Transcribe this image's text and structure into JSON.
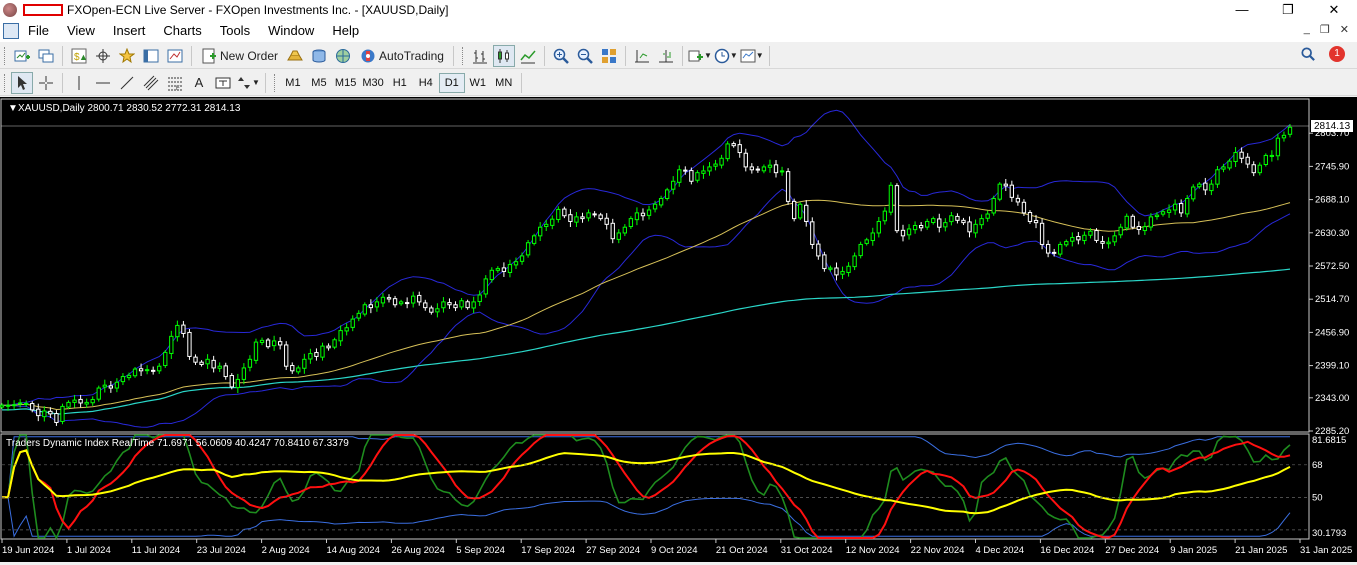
{
  "window": {
    "title": "FXOpen-ECN Live Server - FXOpen Investments Inc. - [XAUUSD,Daily]",
    "controls": [
      "—",
      "❐",
      "✕"
    ]
  },
  "menu": {
    "items": [
      "File",
      "View",
      "Insert",
      "Charts",
      "Tools",
      "Window",
      "Help"
    ],
    "mdi_controls": [
      "_",
      "❐",
      "✕"
    ]
  },
  "toolbar": {
    "new_order_label": "New Order",
    "autotrading_label": "AutoTrading",
    "notification_count": "1"
  },
  "drawing_toolbar": {
    "text_tool": "A",
    "timeframes": [
      "M1",
      "M5",
      "M15",
      "M30",
      "H1",
      "H4",
      "D1",
      "W1",
      "MN"
    ],
    "active_timeframe": "D1"
  },
  "chart": {
    "header": "XAUUSD,Daily  2800.71 2830.52 2772.31 2814.13",
    "current_price": "2814.13",
    "hidden_price_label": "2803.70",
    "indicator_header": "Traders Dynamic Index RealTime 71.6971 56.0609 40.4247 70.8410 67.3379",
    "colors": {
      "background": "#000000",
      "bull_candle": "#00ff00",
      "bear_candle": "#ffffff",
      "bollinger": "#2828d8",
      "ma_mid": "#d6c058",
      "ma_long": "#2ad6c8",
      "rsi_green": "#1e8c1e",
      "signal_red": "#ff1010",
      "mbl_yellow": "#ffff00",
      "volatility_band": "#3a6ee0"
    }
  },
  "chart_data": [
    {
      "type": "candlestick",
      "title": "XAUUSD,Daily",
      "ohlc_last": {
        "open": 2800.71,
        "high": 2830.52,
        "low": 2772.31,
        "close": 2814.13
      },
      "y_ticks": [
        "2803.70",
        "2745.90",
        "2688.10",
        "2630.30",
        "2572.50",
        "2514.70",
        "2456.90",
        "2399.10",
        "2343.00",
        "2285.20"
      ],
      "ylim": [
        2285.2,
        2861.5
      ],
      "x_ticks": [
        "19 Jun 2024",
        "1 Jul 2024",
        "11 Jul 2024",
        "23 Jul 2024",
        "2 Aug 2024",
        "14 Aug 2024",
        "26 Aug 2024",
        "5 Sep 2024",
        "17 Sep 2024",
        "27 Sep 2024",
        "9 Oct 2024",
        "21 Oct 2024",
        "31 Oct 2024",
        "12 Nov 2024",
        "22 Nov 2024",
        "4 Dec 2024",
        "16 Dec 2024",
        "27 Dec 2024",
        "9 Jan 2025",
        "21 Jan 2025",
        "31 Jan 2025"
      ],
      "close": [
        2330,
        2330,
        2331,
        2334,
        2333,
        2322,
        2312,
        2320,
        2315,
        2300,
        2328,
        2335,
        2339,
        2334,
        2335,
        2340,
        2360,
        2365,
        2360,
        2370,
        2380,
        2382,
        2393,
        2390,
        2392,
        2390,
        2398,
        2422,
        2450,
        2469,
        2455,
        2415,
        2405,
        2401,
        2410,
        2395,
        2398,
        2380,
        2362,
        2375,
        2395,
        2410,
        2440,
        2443,
        2432,
        2442,
        2435,
        2398,
        2390,
        2395,
        2410,
        2420,
        2415,
        2433,
        2430,
        2444,
        2460,
        2465,
        2480,
        2490,
        2505,
        2500,
        2510,
        2518,
        2515,
        2505,
        2510,
        2508,
        2520,
        2510,
        2500,
        2492,
        2498,
        2510,
        2505,
        2500,
        2512,
        2500,
        2510,
        2522,
        2550,
        2565,
        2568,
        2563,
        2575,
        2580,
        2590,
        2613,
        2625,
        2640,
        2645,
        2654,
        2671,
        2660,
        2650,
        2658,
        2655,
        2665,
        2662,
        2655,
        2645,
        2620,
        2630,
        2640,
        2655,
        2665,
        2660,
        2670,
        2680,
        2690,
        2705,
        2720,
        2740,
        2738,
        2720,
        2735,
        2738,
        2745,
        2750,
        2760,
        2785,
        2782,
        2770,
        2745,
        2740,
        2740,
        2745,
        2748,
        2735,
        2738,
        2685,
        2655,
        2680,
        2650,
        2610,
        2590,
        2568,
        2569,
        2557,
        2563,
        2572,
        2590,
        2610,
        2618,
        2630,
        2650,
        2668,
        2713,
        2634,
        2625,
        2637,
        2643,
        2639,
        2650,
        2655,
        2640,
        2648,
        2660,
        2652,
        2648,
        2632,
        2645,
        2655,
        2663,
        2690,
        2715,
        2712,
        2692,
        2684,
        2665,
        2650,
        2648,
        2610,
        2595,
        2595,
        2610,
        2615,
        2622,
        2618,
        2626,
        2633,
        2617,
        2612,
        2614,
        2625,
        2640,
        2659,
        2640,
        2636,
        2641,
        2658,
        2661,
        2667,
        2670,
        2680,
        2665,
        2690,
        2710,
        2715,
        2705,
        2715,
        2740,
        2745,
        2755,
        2770,
        2760,
        2750,
        2735,
        2748,
        2765,
        2765,
        2795,
        2800,
        2814
      ]
    },
    {
      "type": "line",
      "title": "Traders Dynamic Index RealTime",
      "values": [
        71.6971,
        56.0609,
        40.4247,
        70.841,
        67.3379
      ],
      "y_ticks": [
        "81.6815",
        "68",
        "50",
        "30.1793"
      ],
      "ylim": [
        27.5,
        84.5
      ]
    }
  ]
}
